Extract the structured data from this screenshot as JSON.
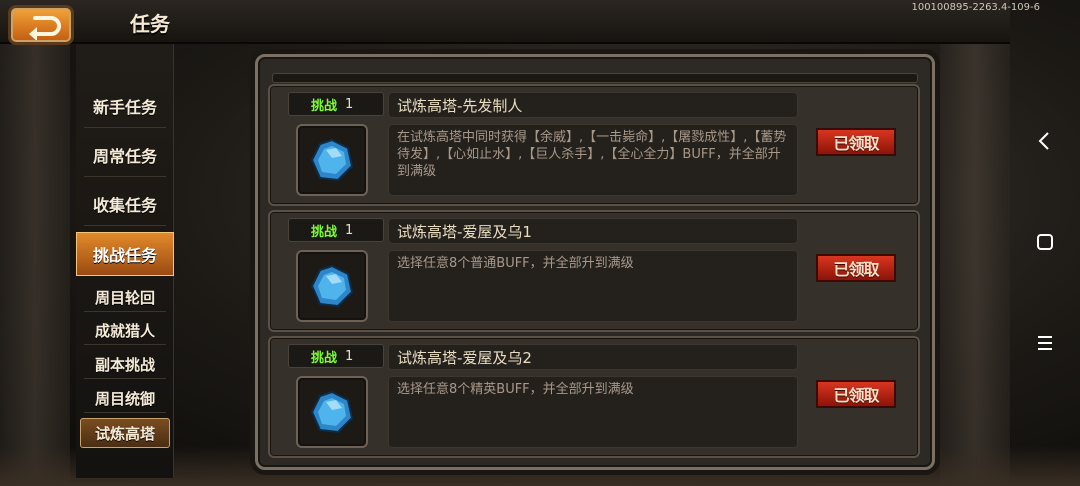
{
  "header": {
    "title": "任务",
    "build_info": "100100895-2263.4-109-6"
  },
  "sidebar": {
    "items": [
      {
        "label": "新手任务"
      },
      {
        "label": "周常任务"
      },
      {
        "label": "收集任务"
      },
      {
        "label": "挑战任务"
      },
      {
        "label": "周目轮回"
      },
      {
        "label": "成就猎人"
      },
      {
        "label": "副本挑战"
      },
      {
        "label": "周目统御"
      },
      {
        "label": "试炼高塔"
      }
    ]
  },
  "tasks": [
    {
      "tag": "挑战",
      "count": "1",
      "title": "试炼高塔-先发制人",
      "description": "在试炼高塔中同时获得【余威】,【一击毙命】,【屠戮成性】,【蓄势待发】,【心如止水】,【巨人杀手】,【全心全力】BUFF，并全部升到满级",
      "status": "已领取",
      "icon": "blue-crystal-icon"
    },
    {
      "tag": "挑战",
      "count": "1",
      "title": "试炼高塔-爱屋及乌1",
      "description": "选择任意8个普通BUFF，并全部升到满级",
      "status": "已领取",
      "icon": "blue-crystal-icon"
    },
    {
      "tag": "挑战",
      "count": "1",
      "title": "试炼高塔-爱屋及乌2",
      "description": "选择任意8个精英BUFF，并全部升到满级",
      "status": "已领取",
      "icon": "blue-crystal-icon"
    }
  ],
  "colors": {
    "accent": "#e28a2a",
    "tag_green": "#7cfc35",
    "stamp_red": "#c8281a"
  }
}
